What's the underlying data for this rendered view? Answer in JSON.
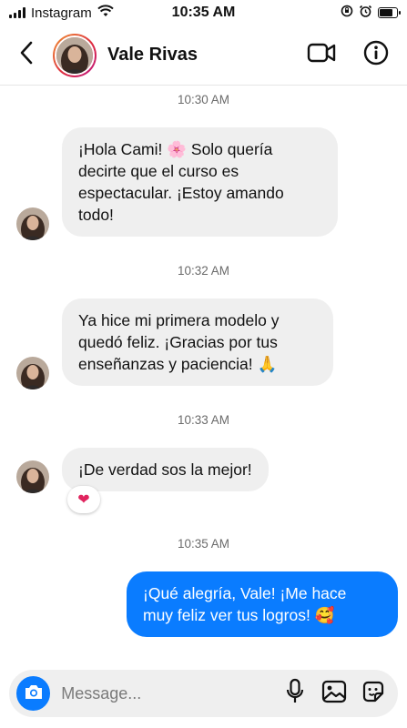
{
  "status_bar": {
    "carrier": "Instagram",
    "time": "10:35 AM",
    "battery_level": 0.8,
    "icons": [
      "signal-icon",
      "wifi-icon",
      "screen-rotation-lock-icon",
      "alarm-icon",
      "battery-icon"
    ]
  },
  "header": {
    "contact_name": "Vale Rivas",
    "icons": [
      "back-arrow-icon",
      "video-call-icon",
      "info-icon"
    ]
  },
  "messages": [
    {
      "timestamp": "10:30 AM",
      "direction": "incoming",
      "lines": [
        "¡Hola Cami! 🌸 Solo quería",
        "decirte que el curso es",
        "espectacular. ¡Estoy amando",
        "todo!"
      ]
    },
    {
      "timestamp": "10:32 AM",
      "direction": "incoming",
      "lines": [
        "Ya hice mi primera modelo y",
        "quedó feliz. ¡Gracias por tus",
        "enseñanzas y paciencia! 🙏"
      ]
    },
    {
      "timestamp": "10:33 AM",
      "direction": "incoming",
      "lines": [
        "¡De verdad sos la mejor!"
      ],
      "reaction": "❤"
    },
    {
      "timestamp": "10:35 AM",
      "direction": "outgoing",
      "lines": [
        "¡Qué alegría, Vale! ¡Me hace",
        "muy feliz ver tus logros! 🥰"
      ]
    }
  ],
  "composer": {
    "placeholder": "Message...",
    "icons": [
      "camera-icon",
      "microphone-icon",
      "gallery-icon",
      "sticker-icon"
    ]
  },
  "colors": {
    "outgoing_bubble": "#0a7cff",
    "incoming_bubble": "#efefef",
    "timestamp_text": "#6b6b6b"
  }
}
